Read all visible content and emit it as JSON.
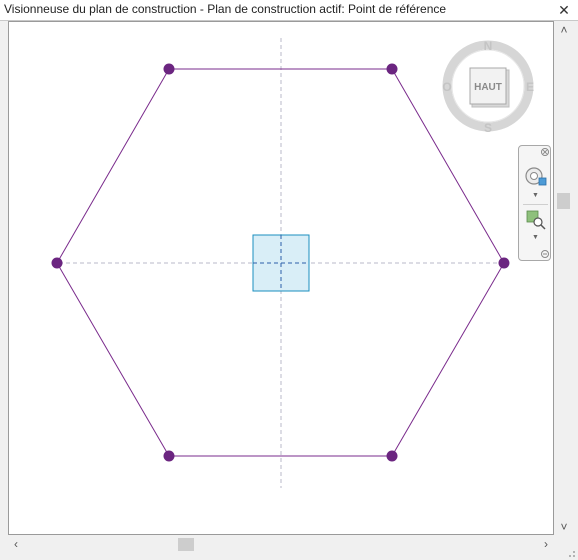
{
  "window": {
    "title": "Visionneuse du plan de construction - Plan de construction actif: Point de référence"
  },
  "viewcube": {
    "face_label": "HAUT",
    "north": "N",
    "south": "S",
    "east": "E",
    "west": "O"
  },
  "colors": {
    "hexagon": "#7a2b8c",
    "vertex": "#6b2580",
    "reference_fill": "#d9eef7",
    "reference_stroke": "#1a8fbf",
    "guides": "#b8b8c8"
  },
  "icons": {
    "navbar_close": "close-icon",
    "steering_wheel": "steering-wheel-icon",
    "zoom": "zoom-extents-icon",
    "scroll_up": "chevron-up-icon",
    "scroll_down": "chevron-down-icon",
    "scroll_left": "chevron-left-icon",
    "scroll_right": "chevron-right-icon"
  }
}
